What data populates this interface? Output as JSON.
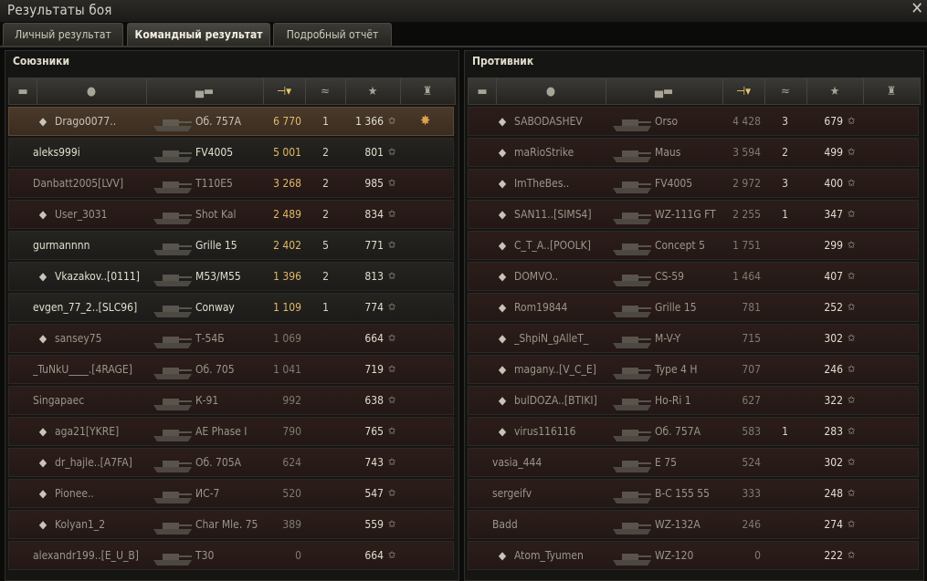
{
  "window": {
    "title": "Результаты боя",
    "close_icon": "close-icon"
  },
  "tabs": [
    {
      "label": "Личный результат",
      "active": false
    },
    {
      "label": "Командный результат",
      "active": true
    },
    {
      "label": "Подробный отчёт",
      "active": false
    }
  ],
  "allies": {
    "title": "Союзники",
    "columns": [
      "squad-icon",
      "player-icon",
      "tank-icon",
      "damage-sort-icon",
      "kills-icon",
      "star-icon",
      "medal-icon"
    ],
    "players": [
      {
        "name": "Drago0077..",
        "vehicle": "Об. 757А",
        "damage": "6 770",
        "kills": "1",
        "xp": "1 366",
        "alive": true,
        "me": true,
        "clan": "clan-emblem",
        "medal": "medal-icon"
      },
      {
        "name": "aleks999i",
        "vehicle": "FV4005",
        "damage": "5 001",
        "kills": "2",
        "xp": "801",
        "alive": true
      },
      {
        "name": "Danbatt2005[LVV]",
        "vehicle": "T110E5",
        "damage": "3 268",
        "kills": "2",
        "xp": "985",
        "alive": false
      },
      {
        "name": "User_3031",
        "vehicle": "Shot Kal",
        "damage": "2 489",
        "kills": "2",
        "xp": "834",
        "alive": false,
        "clan": "warning-emblem"
      },
      {
        "name": "gurmannnn",
        "vehicle": "Grille 15",
        "damage": "2 402",
        "kills": "5",
        "xp": "771",
        "alive": true
      },
      {
        "name": "Vkazakov..[0111]",
        "vehicle": "M53/M55",
        "damage": "1 396",
        "kills": "2",
        "xp": "813",
        "alive": true,
        "clan": "clan-emblem"
      },
      {
        "name": "evgen_77_2..[SLC96]",
        "vehicle": "Conway",
        "damage": "1 109",
        "kills": "1",
        "xp": "774",
        "alive": true
      },
      {
        "name": "sansey75",
        "vehicle": "Т-54Б",
        "damage": "1 069",
        "kills": "",
        "xp": "664",
        "alive": false,
        "clan": "clan-emblem"
      },
      {
        "name": "_TuNkU____.[4RAGE]",
        "vehicle": "Об. 705",
        "damage": "1 041",
        "kills": "",
        "xp": "719",
        "alive": false
      },
      {
        "name": "Singapaec",
        "vehicle": "К-91",
        "damage": "992",
        "kills": "",
        "xp": "638",
        "alive": false
      },
      {
        "name": "aga21[YKRE]",
        "vehicle": "AE Phase I",
        "damage": "790",
        "kills": "",
        "xp": "765",
        "alive": false,
        "clan": "clan-emblem"
      },
      {
        "name": "dr_hajle..[A7FA]",
        "vehicle": "Об. 705А",
        "damage": "624",
        "kills": "",
        "xp": "743",
        "alive": false,
        "clan": "clan-emblem"
      },
      {
        "name": "Pionee..",
        "vehicle": "ИС-7",
        "damage": "520",
        "kills": "",
        "xp": "547",
        "alive": false,
        "clan": "b-emblem"
      },
      {
        "name": "Kolyan1_2",
        "vehicle": "Char Mle. 75",
        "damage": "389",
        "kills": "",
        "xp": "559",
        "alive": false,
        "clan": "clan-emblem"
      },
      {
        "name": "alexandr199..[E_U_B]",
        "vehicle": "T30",
        "damage": "0",
        "kills": "",
        "xp": "664",
        "alive": false
      }
    ]
  },
  "enemies": {
    "title": "Противник",
    "players": [
      {
        "name": "SABODASHEV",
        "vehicle": "Orso",
        "damage": "4 428",
        "kills": "3",
        "xp": "679",
        "alive": false,
        "clan": "clan-emblem"
      },
      {
        "name": "maRioStrike",
        "vehicle": "Maus",
        "damage": "3 594",
        "kills": "2",
        "xp": "499",
        "alive": false,
        "clan": "clan-emblem"
      },
      {
        "name": "ImTheBes..",
        "vehicle": "FV4005",
        "damage": "2 972",
        "kills": "3",
        "xp": "400",
        "alive": false,
        "clan": "b-emblem"
      },
      {
        "name": "SAN11..[SIMS4]",
        "vehicle": "WZ-111G FT",
        "damage": "2 255",
        "kills": "1",
        "xp": "347",
        "alive": false,
        "clan": "clan-emblem"
      },
      {
        "name": "C_T_A..[POOLK]",
        "vehicle": "Concept 5",
        "damage": "1 751",
        "kills": "",
        "xp": "299",
        "alive": false,
        "clan": "clan-emblem"
      },
      {
        "name": "DOMVO..",
        "vehicle": "CS-59",
        "damage": "1 464",
        "kills": "",
        "xp": "407",
        "alive": false,
        "clan": "clan-emblem"
      },
      {
        "name": "Rom19844",
        "vehicle": "Grille 15",
        "damage": "781",
        "kills": "",
        "xp": "252",
        "alive": false,
        "clan": "clan-emblem"
      },
      {
        "name": "_ShpiN_gAlleT_",
        "vehicle": "M-V-Y",
        "damage": "715",
        "kills": "",
        "xp": "302",
        "alive": false,
        "clan": "clan-emblem"
      },
      {
        "name": "magany..[V_C_E]",
        "vehicle": "Type 4 H",
        "damage": "707",
        "kills": "",
        "xp": "246",
        "alive": false,
        "clan": "clan-emblem"
      },
      {
        "name": "bulDOZA..[BTIKI]",
        "vehicle": "Ho-Ri 1",
        "damage": "627",
        "kills": "",
        "xp": "322",
        "alive": false,
        "clan": "clan-emblem"
      },
      {
        "name": "virus116116",
        "vehicle": "Об. 757А",
        "damage": "583",
        "kills": "1",
        "xp": "283",
        "alive": false,
        "clan": "clan-emblem"
      },
      {
        "name": "vasia_444",
        "vehicle": "E 75",
        "damage": "524",
        "kills": "",
        "xp": "302",
        "alive": false
      },
      {
        "name": "sergeifv",
        "vehicle": "В-С 155 55",
        "damage": "333",
        "kills": "",
        "xp": "248",
        "alive": false
      },
      {
        "name": "Badd",
        "vehicle": "WZ-132A",
        "damage": "246",
        "kills": "",
        "xp": "274",
        "alive": false
      },
      {
        "name": "Atom_Tyumen",
        "vehicle": "WZ-120",
        "damage": "0",
        "kills": "",
        "xp": "222",
        "alive": false,
        "clan": "clan-emblem"
      }
    ]
  },
  "colors": {
    "damage_high": "#e0b966",
    "damage_low": "#7f7b70",
    "accent": "#e8c86a"
  }
}
